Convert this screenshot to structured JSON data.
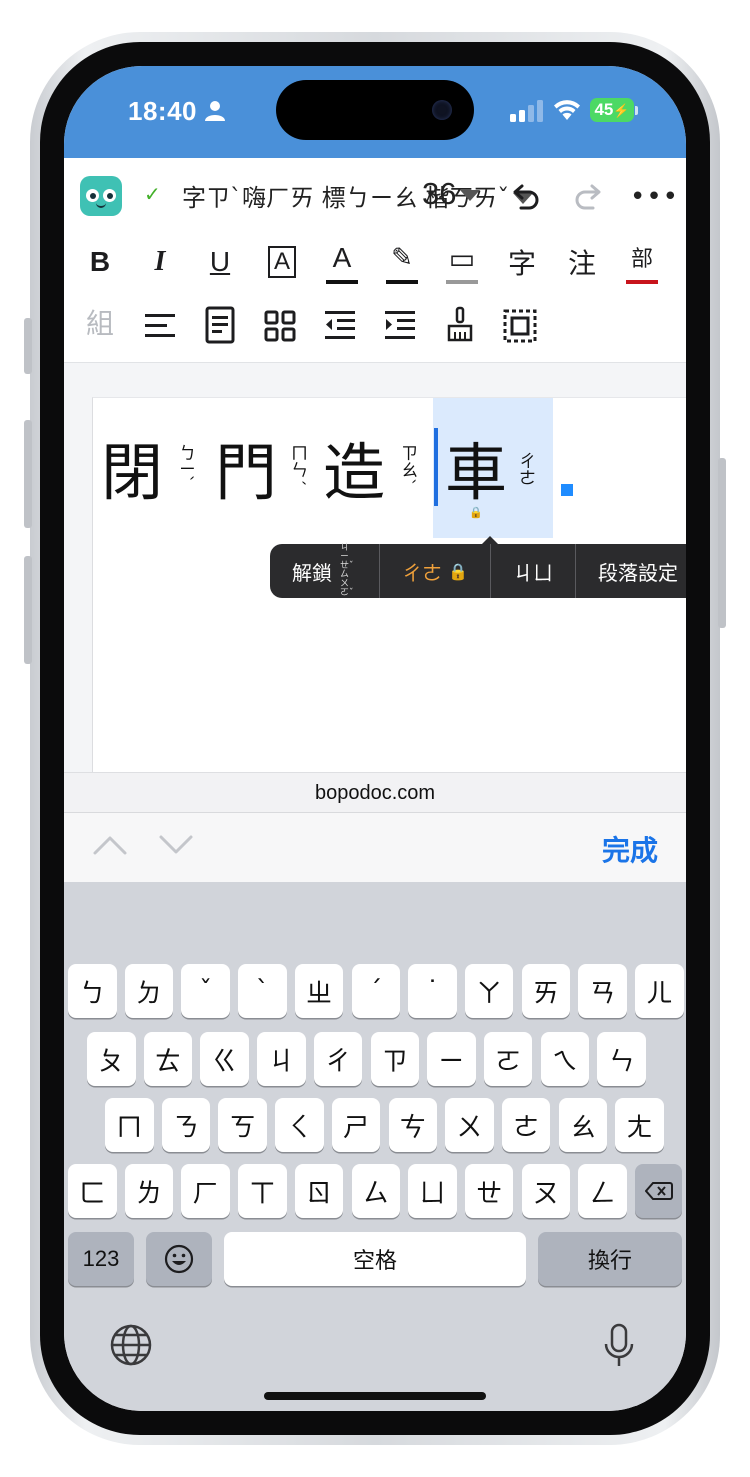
{
  "status": {
    "time": "18:40",
    "battery": "45"
  },
  "toolbar": {
    "font_name": "字ㄗˋ嗨ㄏㄞ 標ㄅㄧㄠ 楷ㄎㄞˇ",
    "font_size": "36"
  },
  "format_row1": [
    {
      "label": "B"
    },
    {
      "label": "I"
    },
    {
      "label": "U"
    },
    {
      "label": "A"
    },
    {
      "label": "A"
    },
    {
      "label": "✎"
    },
    {
      "label": "▭"
    },
    {
      "label": "字"
    },
    {
      "label": "注"
    },
    {
      "label": "部"
    }
  ],
  "format_row2": [
    {
      "label": "組"
    }
  ],
  "document": {
    "characters": [
      {
        "char": "閉",
        "zhuyin": "ㄅㄧˋ"
      },
      {
        "char": "門",
        "zhuyin": "ㄇㄣˊ"
      },
      {
        "char": "造",
        "zhuyin": "ㄗㄠˋ"
      },
      {
        "char": "車",
        "zhuyin": "ㄔㄜ"
      }
    ]
  },
  "context_menu": {
    "unlock": "解鎖",
    "unlock_zhuyin": "ㄐㄧㄝˇ ㄙㄨㄛˇ",
    "reading_locked": "ㄔㄜ",
    "reading_alt": "ㄐㄩ",
    "paragraph": "段落設定"
  },
  "browser": {
    "url": "bopodoc.com",
    "done": "完成"
  },
  "keyboard": {
    "row1": [
      "ㄅ",
      "ㄉ",
      "ˇ",
      "ˋ",
      "ㄓ",
      "ˊ",
      "˙",
      "ㄚ",
      "ㄞ",
      "ㄢ",
      "ㄦ"
    ],
    "row2": [
      "ㄆ",
      "ㄊ",
      "ㄍ",
      "ㄐ",
      "ㄔ",
      "ㄗ",
      "ㄧ",
      "ㄛ",
      "ㄟ",
      "ㄣ"
    ],
    "row3": [
      "ㄇ",
      "ㄋ",
      "ㄎ",
      "ㄑ",
      "ㄕ",
      "ㄘ",
      "ㄨ",
      "ㄜ",
      "ㄠ",
      "ㄤ"
    ],
    "row4": [
      "ㄈ",
      "ㄌ",
      "ㄏ",
      "ㄒ",
      "ㄖ",
      "ㄙ",
      "ㄩ",
      "ㄝ",
      "ㄡ",
      "ㄥ"
    ],
    "numbers": "123",
    "space": "空格",
    "return": "換行"
  }
}
